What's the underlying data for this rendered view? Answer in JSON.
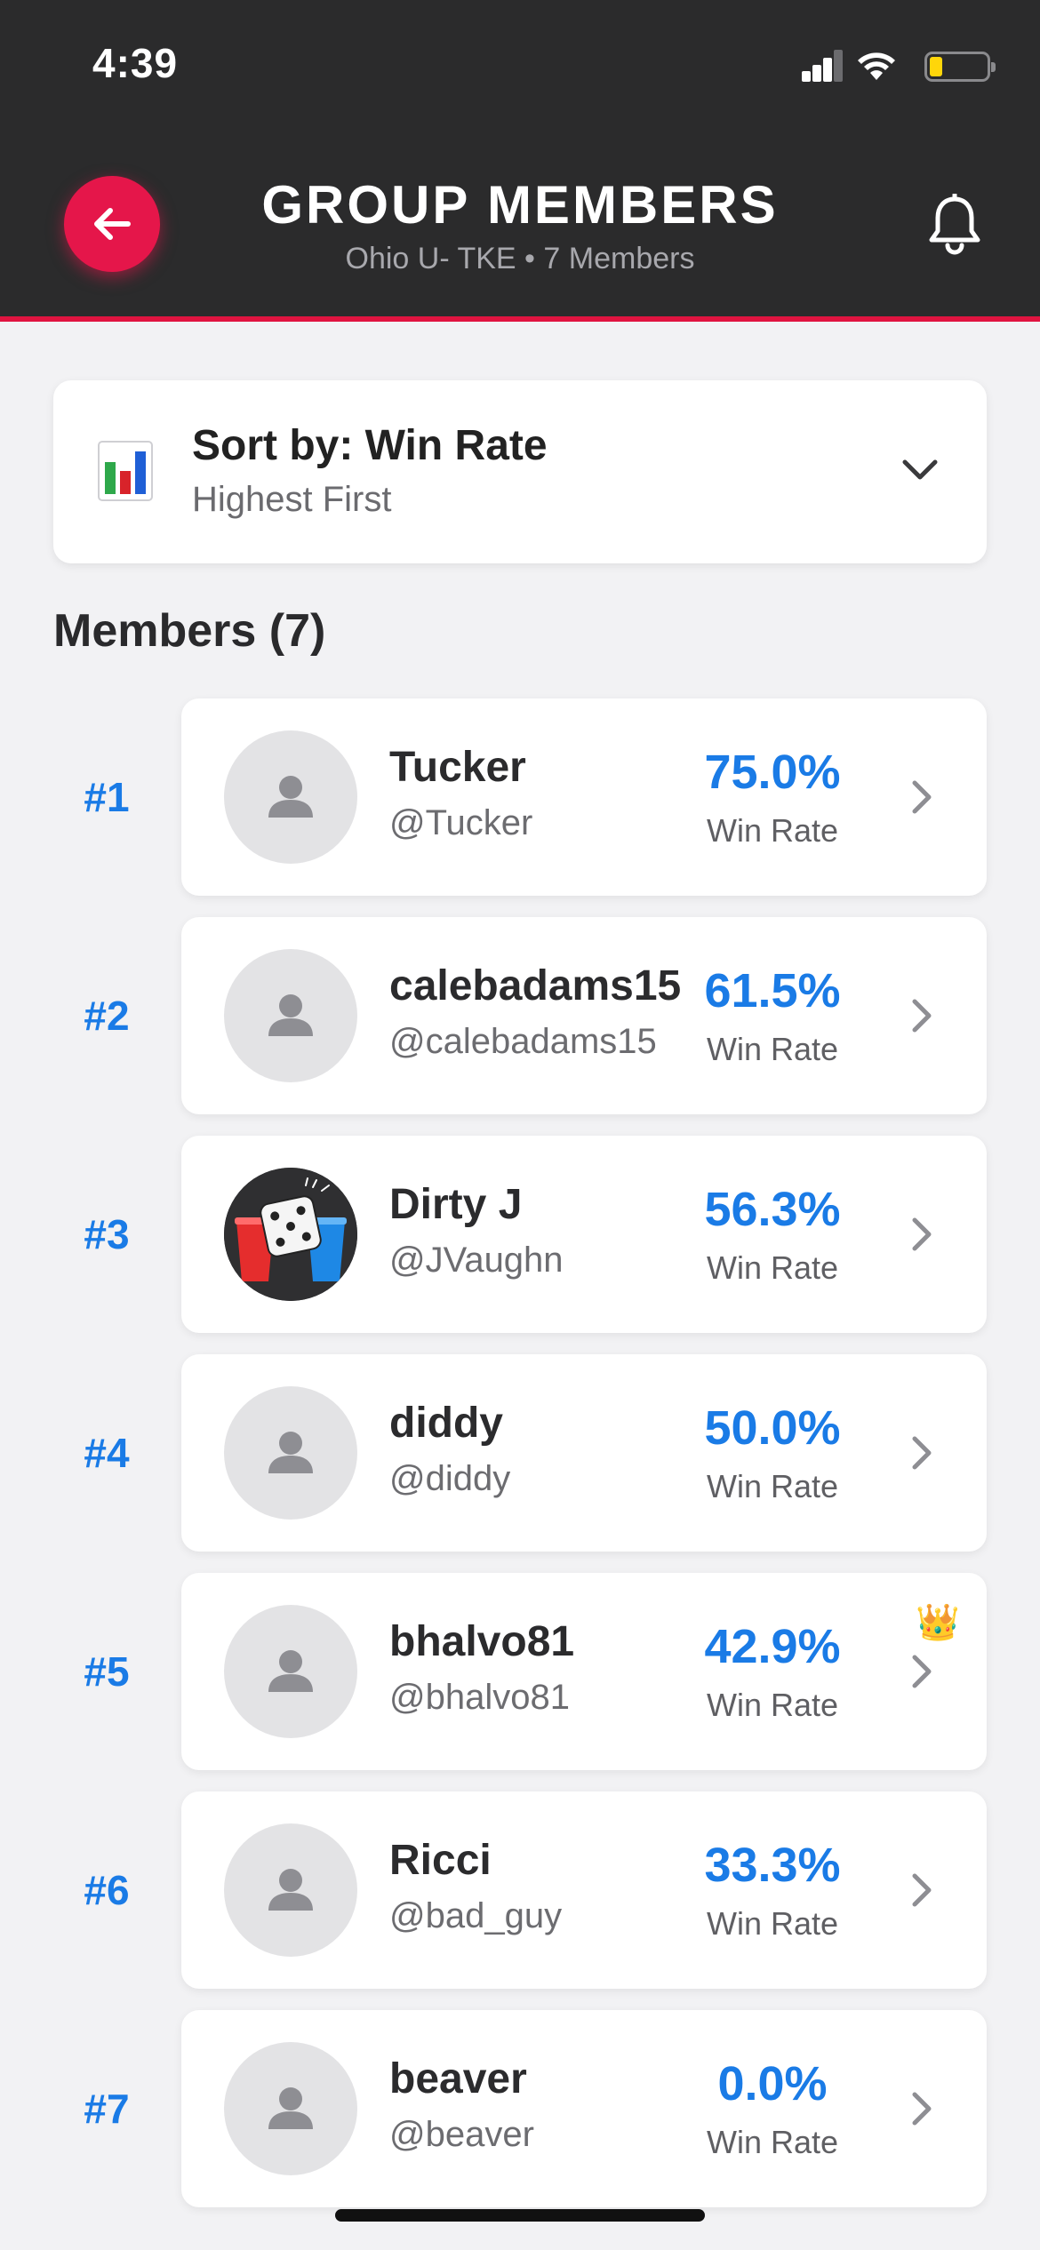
{
  "status_bar": {
    "time": "4:39"
  },
  "header": {
    "title": "GROUP MEMBERS",
    "subtitle": "Ohio U- TKE • 7 Members"
  },
  "sort": {
    "title": "Sort by: Win Rate",
    "subtitle": "Highest First"
  },
  "members_heading": "Members (7)",
  "members": [
    {
      "rank": "#1",
      "name": "Tucker",
      "handle": "@Tucker",
      "win_rate": "75.0%",
      "win_rate_label": "Win Rate",
      "avatar": "person-icon"
    },
    {
      "rank": "#2",
      "name": "calebadams15",
      "handle": "@calebadams15",
      "win_rate": "61.5%",
      "win_rate_label": "Win Rate",
      "avatar": "person-icon"
    },
    {
      "rank": "#3",
      "name": "Dirty J",
      "handle": "@JVaughn",
      "win_rate": "56.3%",
      "win_rate_label": "Win Rate",
      "avatar": "dice-cups-image"
    },
    {
      "rank": "#4",
      "name": "diddy",
      "handle": "@diddy",
      "win_rate": "50.0%",
      "win_rate_label": "Win Rate",
      "avatar": "person-icon"
    },
    {
      "rank": "#5",
      "name": "bhalvo81",
      "handle": "@bhalvo81",
      "win_rate": "42.9%",
      "win_rate_label": "Win Rate",
      "avatar": "person-icon",
      "badge": "crown-icon"
    },
    {
      "rank": "#6",
      "name": "Ricci",
      "handle": "@bad_guy",
      "win_rate": "33.3%",
      "win_rate_label": "Win Rate",
      "avatar": "person-icon"
    },
    {
      "rank": "#7",
      "name": "beaver",
      "handle": "@beaver",
      "win_rate": "0.0%",
      "win_rate_label": "Win Rate",
      "avatar": "person-icon"
    }
  ],
  "colors": {
    "header_bg": "#2b2b2c",
    "accent_red": "#e5164a",
    "rank_blue": "#1a7be6",
    "page_bg": "#f2f2f4"
  }
}
